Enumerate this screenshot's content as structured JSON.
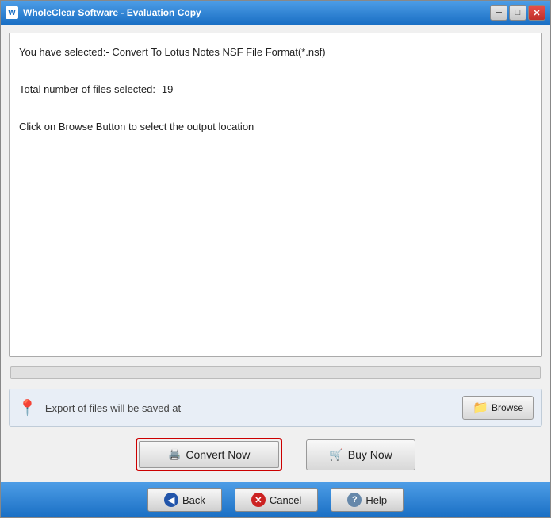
{
  "window": {
    "title": "WholeClear Software - Evaluation Copy"
  },
  "titlebar": {
    "minimize_label": "─",
    "maximize_label": "□",
    "close_label": "✕"
  },
  "infobox": {
    "line1": "You have selected:- Convert To Lotus Notes NSF File Format(*.nsf)",
    "line2": "Total number of files selected:- 19",
    "line3": "Click on Browse Button to select the output location"
  },
  "export": {
    "label": "Export of files will be saved at",
    "browse_label": "Browse"
  },
  "actions": {
    "convert_label": "Convert Now",
    "buy_label": "Buy Now"
  },
  "bottom": {
    "back_label": "Back",
    "cancel_label": "Cancel",
    "help_label": "Help"
  }
}
